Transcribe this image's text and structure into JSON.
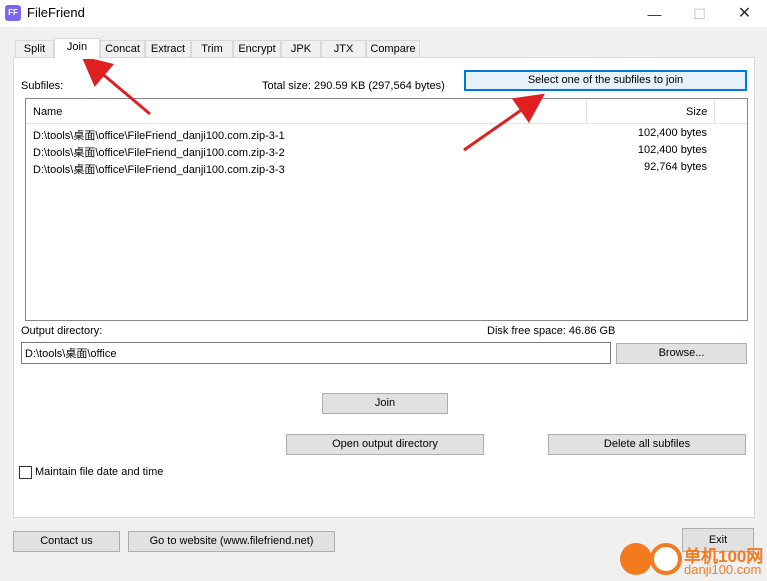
{
  "window": {
    "icon_text": "FF",
    "title": "FileFriend",
    "minimize_glyph": "—",
    "maximize_glyph": "☐",
    "close_glyph": "✕"
  },
  "tabs": [
    {
      "label": "Split"
    },
    {
      "label": "Join"
    },
    {
      "label": "Concat"
    },
    {
      "label": "Extract"
    },
    {
      "label": "Trim"
    },
    {
      "label": "Encrypt"
    },
    {
      "label": "JPK"
    },
    {
      "label": "JTX"
    },
    {
      "label": "Compare"
    }
  ],
  "active_tab": "Join",
  "join": {
    "subfiles_label": "Subfiles:",
    "total_size_text": "Total size: 290.59 KB (297,564 bytes)",
    "select_button": "Select one of the subfiles to join",
    "columns": {
      "name": "Name",
      "size": "Size"
    },
    "rows": [
      {
        "name": "D:\\tools\\桌面\\office\\FileFriend_danji100.com.zip-3-1",
        "size": "102,400 bytes"
      },
      {
        "name": "D:\\tools\\桌面\\office\\FileFriend_danji100.com.zip-3-2",
        "size": "102,400 bytes"
      },
      {
        "name": "D:\\tools\\桌面\\office\\FileFriend_danji100.com.zip-3-3",
        "size": "92,764 bytes"
      }
    ],
    "output_dir_label": "Output directory:",
    "disk_free_text": "Disk free space: 46.86 GB",
    "output_dir_value": "D:\\tools\\桌面\\office",
    "browse_button": "Browse...",
    "join_button": "Join",
    "open_output_button": "Open output directory",
    "delete_all_button": "Delete all subfiles",
    "maintain_checkbox_label": "Maintain file date and time",
    "maintain_checked": false
  },
  "footer": {
    "contact_button": "Contact us",
    "website_button": "Go to website (www.filefriend.net)",
    "exit_button": "Exit"
  },
  "watermark": {
    "text_cn": "单机100网",
    "text_url": "danji100.com"
  },
  "colors": {
    "accent": "#0078d7",
    "arrow": "#e02020",
    "watermark": "#f47a20"
  }
}
